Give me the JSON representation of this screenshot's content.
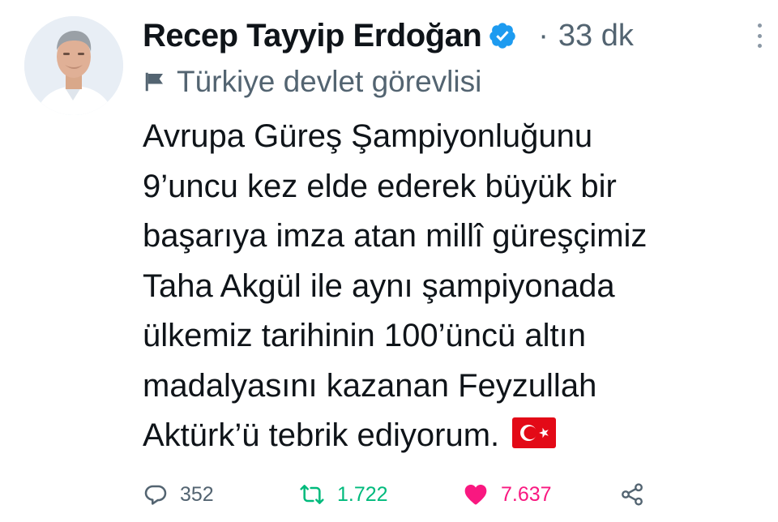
{
  "tweet": {
    "author_name": "Recep Tayyip Erdoğan",
    "separator": "·",
    "time": "33 dk",
    "label": "Türkiye devlet görevlisi",
    "text_lines": [
      "Avrupa Güreş Şampiyonluğunu",
      "9’uncu kez elde ederek büyük bir",
      "başarıya imza atan millî güreşçimiz",
      "Taha Akgül ile aynı şampiyonada",
      "ülkemiz tarihinin 100’üncü altın",
      "madalyasını kazanan Feyzullah",
      "Aktürk’ü tebrik ediyorum."
    ],
    "emoji": "turkey-flag",
    "stats": {
      "replies": "352",
      "retweets": "1.722",
      "likes": "7.637"
    }
  },
  "icons": {
    "verified": "verified-badge-icon",
    "more": "more-options-icon",
    "label": "flag-icon",
    "reply": "reply-icon",
    "retweet": "retweet-icon",
    "like": "heart-icon",
    "share": "share-icon"
  },
  "colors": {
    "text": "#0f1419",
    "secondary": "#536471",
    "verified": "#1d9bf0",
    "retweet": "#00ba7c",
    "like": "#f91880",
    "flag_red": "#e30a17"
  }
}
